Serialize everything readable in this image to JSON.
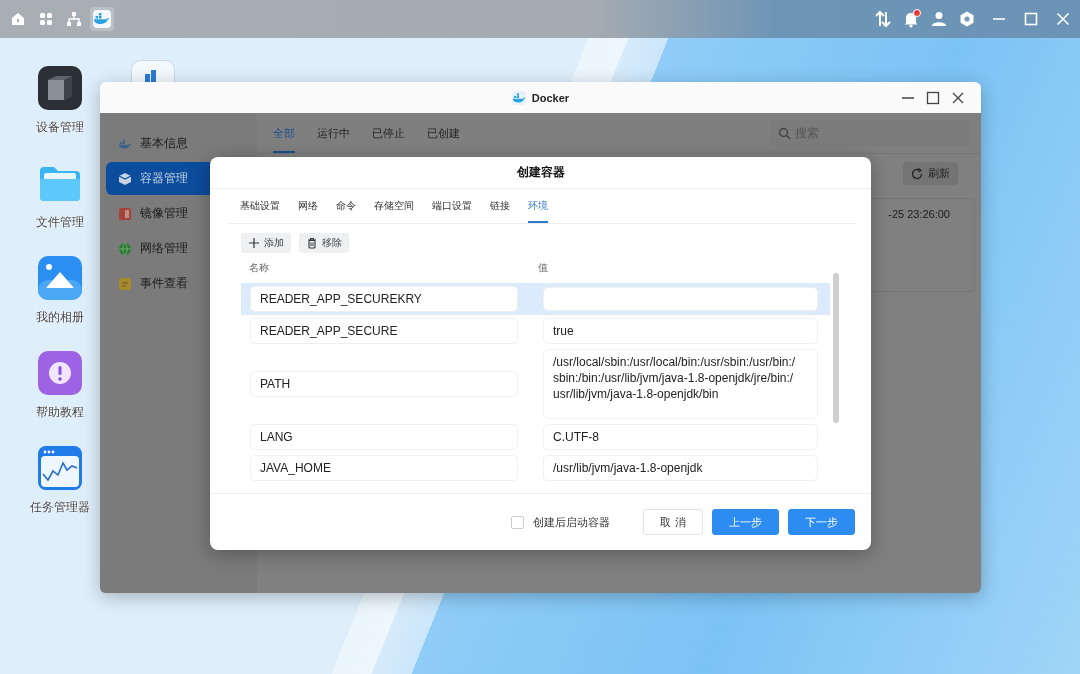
{
  "taskbar": {
    "apps": [
      {
        "selected": false
      },
      {
        "selected": false
      },
      {
        "selected": false
      },
      {
        "selected": true
      }
    ],
    "notifications": {
      "unread": true
    }
  },
  "desktop_icons": [
    {
      "label": "设备管理"
    },
    {
      "label": "文件管理"
    },
    {
      "label": "我的相册"
    },
    {
      "label": "帮助教程"
    },
    {
      "label": "任务管理器"
    }
  ],
  "docker_window": {
    "title": "Docker",
    "sidebar": {
      "items": [
        {
          "label": "基本信息",
          "selected": false
        },
        {
          "label": "容器管理",
          "selected": true
        },
        {
          "label": "镜像管理",
          "selected": false
        },
        {
          "label": "网络管理",
          "selected": false
        },
        {
          "label": "事件查看",
          "selected": false
        }
      ]
    },
    "tabs": [
      {
        "label": "全部",
        "selected": true
      },
      {
        "label": "运行中",
        "selected": false
      },
      {
        "label": "已停止",
        "selected": false
      },
      {
        "label": "已创建",
        "selected": false
      }
    ],
    "search": {
      "placeholder": "搜索"
    },
    "refresh_button": "刷新",
    "card_text": "-25 23:26:00"
  },
  "dialog": {
    "title": "创建容器",
    "tabs": [
      {
        "label": "基础设置",
        "selected": false
      },
      {
        "label": "网络",
        "selected": false
      },
      {
        "label": "命令",
        "selected": false
      },
      {
        "label": "存储空间",
        "selected": false
      },
      {
        "label": "端口设置",
        "selected": false
      },
      {
        "label": "链接",
        "selected": false
      },
      {
        "label": "环境",
        "selected": true
      }
    ],
    "toolbar": [
      {
        "kind": "add",
        "label": "添加"
      },
      {
        "kind": "remove",
        "label": "移除"
      }
    ],
    "columns": [
      "名称",
      "值"
    ],
    "rows": [
      {
        "name": "READER_APP_SECUREKRY",
        "selected": true
      },
      {
        "name": "READER_APP_SECURE",
        "value": "true",
        "selected": false
      },
      {
        "name": "PATH",
        "value": "/usr/local/sbin:/usr/local/bin:/usr/sbin:/usr/bin:/sbin:/bin:/usr/lib/jvm/java-1.8-openjdk/jre/bin:/usr/lib/jvm/java-1.8-openjdk/bin",
        "selected": false
      },
      {
        "name": "LANG",
        "value": "C.UTF-8",
        "selected": false
      },
      {
        "name": "JAVA_HOME",
        "value": "/usr/lib/jvm/java-1.8-openjdk",
        "selected": false
      }
    ],
    "start_after_create": {
      "label": "创建后启动容器",
      "checked": false
    },
    "buttons": [
      {
        "label": "取 消",
        "kind": "default"
      },
      {
        "label": "上一步",
        "kind": "primary"
      },
      {
        "label": "下一步",
        "kind": "primary"
      }
    ]
  }
}
